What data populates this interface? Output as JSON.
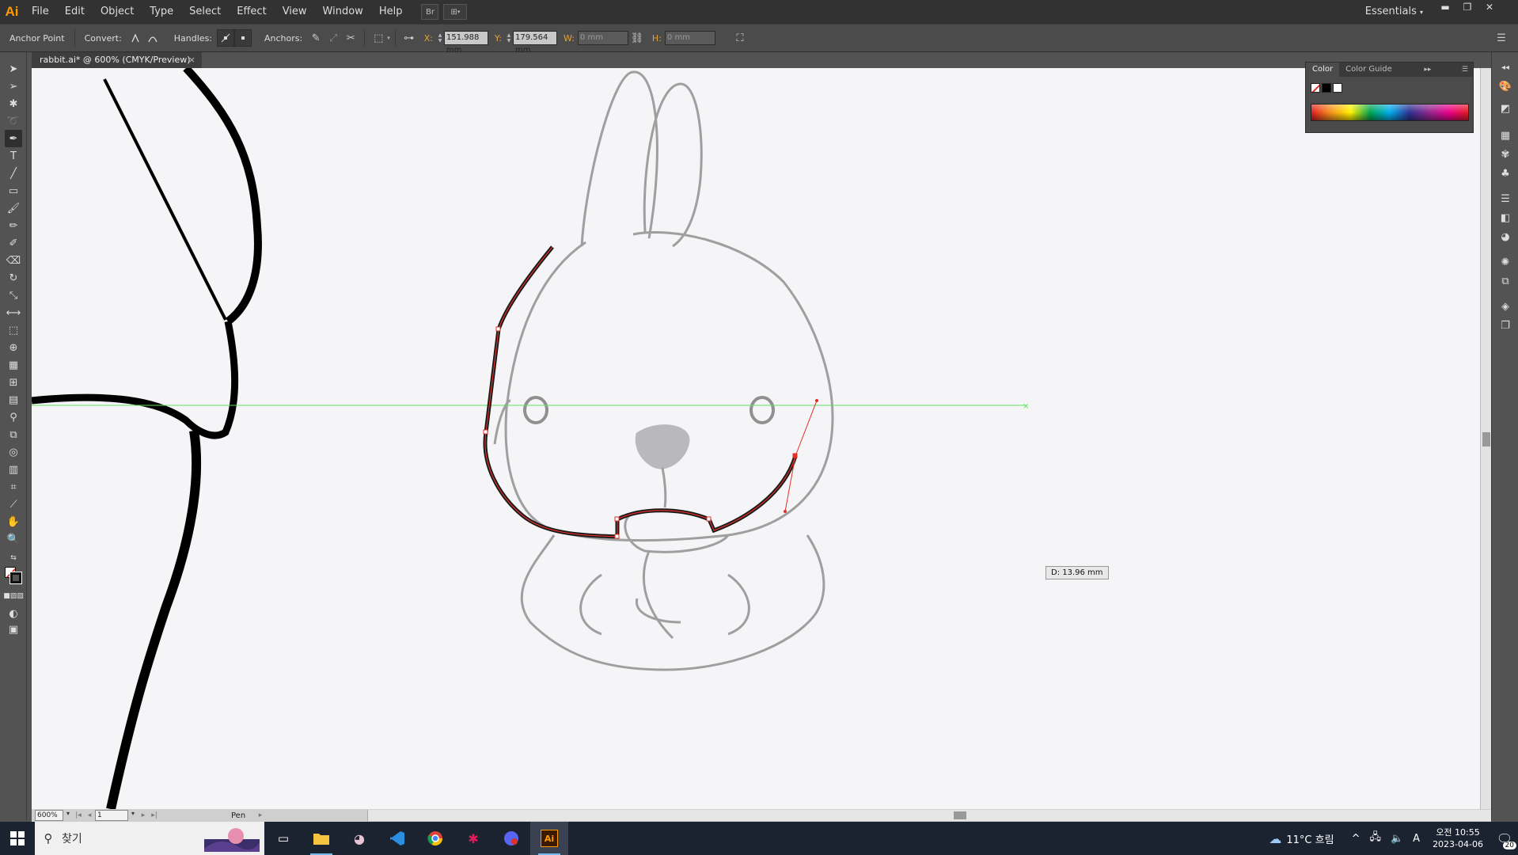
{
  "app": {
    "logo": "Ai",
    "workspace": "Essentials"
  },
  "menu": [
    "File",
    "Edit",
    "Object",
    "Type",
    "Select",
    "Effect",
    "View",
    "Window",
    "Help"
  ],
  "menu_buttons": {
    "bridge": "Br",
    "arrange": "⊞"
  },
  "control": {
    "selection_label": "Anchor Point",
    "convert_label": "Convert:",
    "handles_label": "Handles:",
    "anchors_label": "Anchors:",
    "x_label": "X:",
    "x_value": "151.988 mm",
    "y_label": "Y:",
    "y_value": "179.564 mm",
    "w_label": "W:",
    "w_value": "0 mm",
    "h_label": "H:",
    "h_value": "0 mm"
  },
  "document_tab": {
    "title": "rabbit.ai* @ 600% (CMYK/Preview)",
    "close": "×"
  },
  "canvas": {
    "measure_label": "D: 13.96 mm"
  },
  "status": {
    "zoom": "600%",
    "page": "1",
    "tool": "Pen"
  },
  "color_panel": {
    "tabs": [
      "Color",
      "Color Guide"
    ],
    "active_tab": "Color"
  },
  "taskbar": {
    "search_placeholder": "찾기",
    "weather": "11°C  흐림",
    "time_line1": "오전 10:55",
    "time_line2": "2023-04-06",
    "notifications": "20",
    "ime": "A"
  },
  "colors": {
    "accent_orange": "#ff9a00",
    "canvas_bg": "#f5f5f8",
    "guide_green": "#5ee25e",
    "path_red": "#e0302a"
  }
}
